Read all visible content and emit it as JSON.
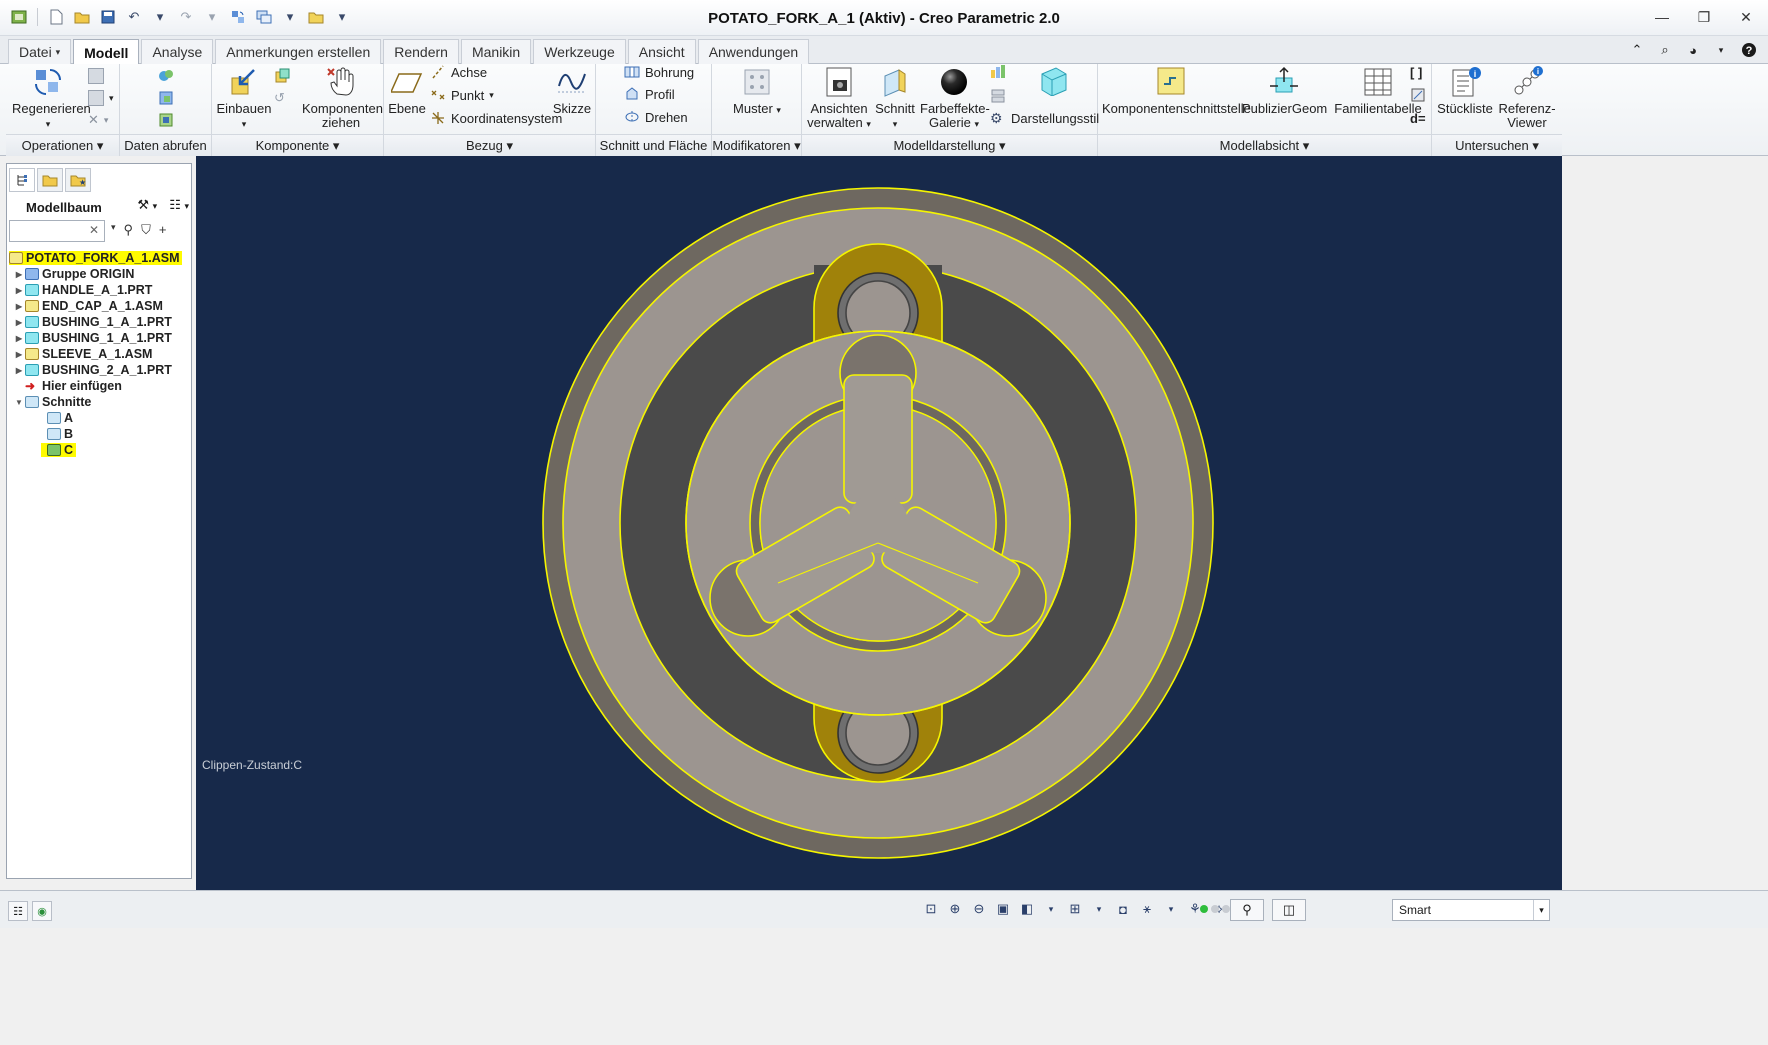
{
  "window": {
    "title": "POTATO_FORK_A_1 (Aktiv) - Creo Parametric 2.0",
    "controls": [
      "minimize-icon",
      "maximize-icon",
      "close-icon"
    ]
  },
  "quick_access": [
    "save-icon",
    "new-icon",
    "open-icon",
    "undo-icon",
    "redo-icon",
    "regenerate-icon",
    "window-icon",
    "close-window-icon"
  ],
  "tabs": [
    {
      "label": "Datei",
      "dropdown": "▾"
    },
    {
      "label": "Modell"
    },
    {
      "label": "Analyse"
    },
    {
      "label": "Anmerkungen erstellen"
    },
    {
      "label": "Rendern"
    },
    {
      "label": "Manikin"
    },
    {
      "label": "Werkzeuge"
    },
    {
      "label": "Ansicht"
    },
    {
      "label": "Anwendungen"
    }
  ],
  "ribbon": {
    "operationen": {
      "label": "Operationen",
      "regenerieren": "Regenerieren"
    },
    "daten_abrufen": {
      "label": "Daten abrufen"
    },
    "komponente": {
      "label": "Komponente",
      "einbauen": "Einbauen",
      "komponenten_ziehen_1": "Komponenten",
      "komponenten_ziehen_2": "ziehen"
    },
    "bezug": {
      "label": "Bezug",
      "ebene": "Ebene",
      "achse": "Achse",
      "punkt": "Punkt",
      "koordinatensystem": "Koordinatensystem",
      "skizze": "Skizze"
    },
    "schnitt_flaeche": {
      "label": "Schnitt und Fläche",
      "bohrung": "Bohrung",
      "profil": "Profil",
      "drehen": "Drehen"
    },
    "modifikatoren": {
      "label": "Modifikatoren",
      "muster": "Muster"
    },
    "modelldarstellung": {
      "label": "Modelldarstellung",
      "ansichten_1": "Ansichten",
      "ansichten_2": "verwalten",
      "schnitt": "Schnitt",
      "farbeffekte_1": "Farbeffekte-",
      "farbeffekte_2": "Galerie",
      "darstellungsstil": "Darstellungsstil"
    },
    "modellabsicht": {
      "label": "Modellabsicht",
      "komponentenschnittstelle": "Komponentenschnittstelle",
      "publiziergeom": "PublizierGeom",
      "familientabelle": "Familientabelle"
    },
    "untersuchen": {
      "label": "Untersuchen",
      "stueckliste": "Stückliste",
      "referenz_1": "Referenz-",
      "referenz_2": "Viewer"
    }
  },
  "model_tree": {
    "title": "Modellbaum",
    "search_value": "",
    "items": [
      {
        "label": "POTATO_FORK_A_1.ASM",
        "highlighted": true,
        "level": 0,
        "expander": "",
        "icon": "assembly-icon"
      },
      {
        "label": "Gruppe ORIGIN",
        "level": 1,
        "expander": "▶",
        "icon": "group-icon"
      },
      {
        "label": "HANDLE_A_1.PRT",
        "level": 1,
        "expander": "▶",
        "icon": "part-icon"
      },
      {
        "label": "END_CAP_A_1.ASM",
        "level": 1,
        "expander": "▶",
        "icon": "assembly-icon"
      },
      {
        "label": "BUSHING_1_A_1.PRT",
        "level": 1,
        "expander": "▶",
        "icon": "part-icon"
      },
      {
        "label": "BUSHING_1_A_1.PRT",
        "level": 1,
        "expander": "▶",
        "icon": "part-icon"
      },
      {
        "label": "SLEEVE_A_1.ASM",
        "level": 1,
        "expander": "▶",
        "icon": "assembly-icon"
      },
      {
        "label": "BUSHING_2_A_1.PRT",
        "level": 1,
        "expander": "▶",
        "icon": "part-icon"
      },
      {
        "label": "Hier einfügen",
        "level": 1,
        "expander": "",
        "icon": "insert-arrow-icon"
      },
      {
        "label": "Schnitte",
        "level": 1,
        "expander": "▼",
        "icon": "sections-icon"
      },
      {
        "label": "A",
        "level": 2,
        "expander": "",
        "icon": "section-icon"
      },
      {
        "label": "B",
        "level": 2,
        "expander": "",
        "icon": "section-icon"
      },
      {
        "label": "C",
        "level": 2,
        "expander": "",
        "icon": "section-active-icon",
        "highlighted": true
      }
    ]
  },
  "viewport": {
    "clip_state": "Clippen-Zustand:C",
    "background": "#17294a",
    "highlight_color": "#f5f500"
  },
  "statusbar": {
    "filter_value": "Smart"
  }
}
